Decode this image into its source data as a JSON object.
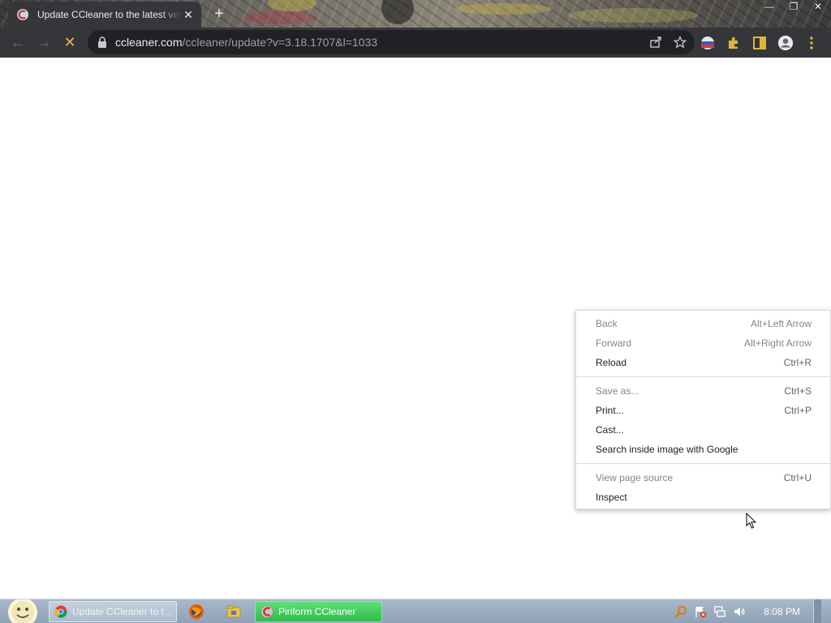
{
  "browser": {
    "tab": {
      "title": "Update CCleaner to the latest version",
      "close": "✕"
    },
    "new_tab": "+",
    "window_controls": {
      "minimize": "—",
      "restore": "❐",
      "close": "✕"
    },
    "nav": {
      "back": "←",
      "forward": "→",
      "stop": "✕"
    },
    "omnibox": {
      "host": "ccleaner.com",
      "path": "/ccleaner/update?v=3.18.1707&l=1033"
    },
    "icons": [
      "lock-icon",
      "share-icon",
      "star-icon",
      "profile-icon",
      "extensions-icon",
      "side-panel-icon",
      "account-icon",
      "menu-icon"
    ]
  },
  "context_menu": {
    "groups": [
      [
        {
          "label": "Back",
          "shortcut": "Alt+Left Arrow",
          "disabled": true
        },
        {
          "label": "Forward",
          "shortcut": "Alt+Right Arrow",
          "disabled": true
        },
        {
          "label": "Reload",
          "shortcut": "Ctrl+R",
          "disabled": false
        }
      ],
      [
        {
          "label": "Save as...",
          "shortcut": "Ctrl+S",
          "disabled": true
        },
        {
          "label": "Print...",
          "shortcut": "Ctrl+P",
          "disabled": false
        },
        {
          "label": "Cast...",
          "shortcut": "",
          "disabled": false
        },
        {
          "label": "Search inside image with Google",
          "shortcut": "",
          "disabled": false
        }
      ],
      [
        {
          "label": "View page source",
          "shortcut": "Ctrl+U",
          "disabled": true
        },
        {
          "label": "Inspect",
          "shortcut": "",
          "disabled": false
        }
      ]
    ]
  },
  "taskbar": {
    "tasks": {
      "chrome": "Update CCleaner to t...",
      "ccleaner": "Piriform CCleaner"
    },
    "clock": "8:08 PM"
  },
  "colors": {
    "chrome_dark": "#35363a",
    "omnibox_bg": "#202124",
    "taskbar": "#9fb0c4",
    "ccleaner_task": "#2cbb46"
  }
}
